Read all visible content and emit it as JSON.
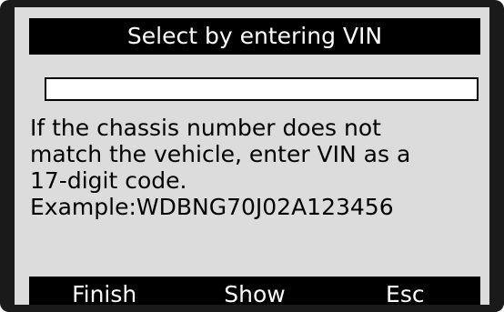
{
  "header": {
    "title": "Select by entering VIN"
  },
  "vin_field": {
    "value": "",
    "placeholder": ""
  },
  "message": {
    "lines": [
      "If the chassis number does not",
      "match the vehicle, enter VIN as a",
      "17-digit code.",
      "Example:WDBNG70J02A123456"
    ]
  },
  "footer": {
    "finish_label": "Finish",
    "show_label": "Show",
    "esc_label": "Esc"
  },
  "colors": {
    "screen_background": "#dcdcdc",
    "bar_background": "#000000",
    "bar_text": "#ffffff",
    "bezel": "#1a1a1a"
  }
}
